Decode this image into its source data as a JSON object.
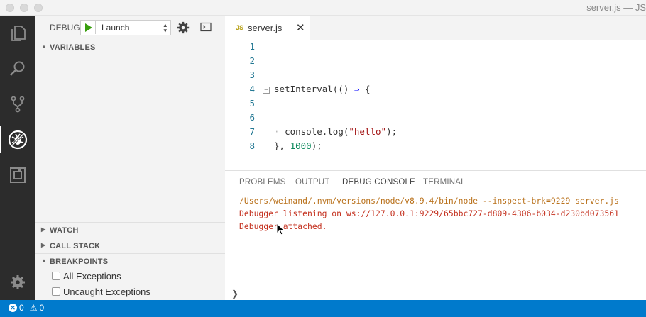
{
  "window": {
    "title": "server.js — JS"
  },
  "debug_toolbar": {
    "label": "DEBUG",
    "launch_config": "Launch"
  },
  "sidebar": {
    "variables_label": "VARIABLES",
    "watch_label": "WATCH",
    "call_stack_label": "CALL STACK",
    "breakpoints_label": "BREAKPOINTS",
    "breakpoints": [
      {
        "label": "All Exceptions",
        "checked": false
      },
      {
        "label": "Uncaught Exceptions",
        "checked": false
      }
    ]
  },
  "editor": {
    "tab": {
      "badge": "JS",
      "name": "server.js",
      "close": "✕"
    },
    "line_numbers": [
      "1",
      "2",
      "3",
      "4",
      "5",
      "6",
      "7",
      "8"
    ],
    "code": {
      "l4_fn": "setInterval(() ",
      "l4_arrow": "⇒",
      "l4_brace": " {",
      "l7_call": "console.log(",
      "l7_str": "\"hello\"",
      "l7_end": ");",
      "l8_start": "}, ",
      "l8_num": "1000",
      "l8_end": ");"
    }
  },
  "panel": {
    "tabs": [
      "PROBLEMS",
      "OUTPUT",
      "DEBUG CONSOLE",
      "TERMINAL"
    ],
    "active_tab": "DEBUG CONSOLE",
    "console_lines": [
      "/Users/weinand/.nvm/versions/node/v8.9.4/bin/node --inspect-brk=9229 server.js",
      "Debugger listening on ws://127.0.0.1:9229/65bbc727-d809-4306-b034-d230bd073561",
      "Debugger attached."
    ],
    "repl_prompt": "❯"
  },
  "statusbar": {
    "errors": "0",
    "warnings": "0"
  },
  "colors": {
    "accent": "#007acc",
    "activity_bar": "#2c2c2c",
    "console_error": "#c4311f",
    "console_path": "#b9711b"
  },
  "icons": {
    "activity": [
      "explorer-icon",
      "search-icon",
      "source-control-icon",
      "debug-icon",
      "extensions-icon",
      "settings-gear-icon"
    ]
  }
}
